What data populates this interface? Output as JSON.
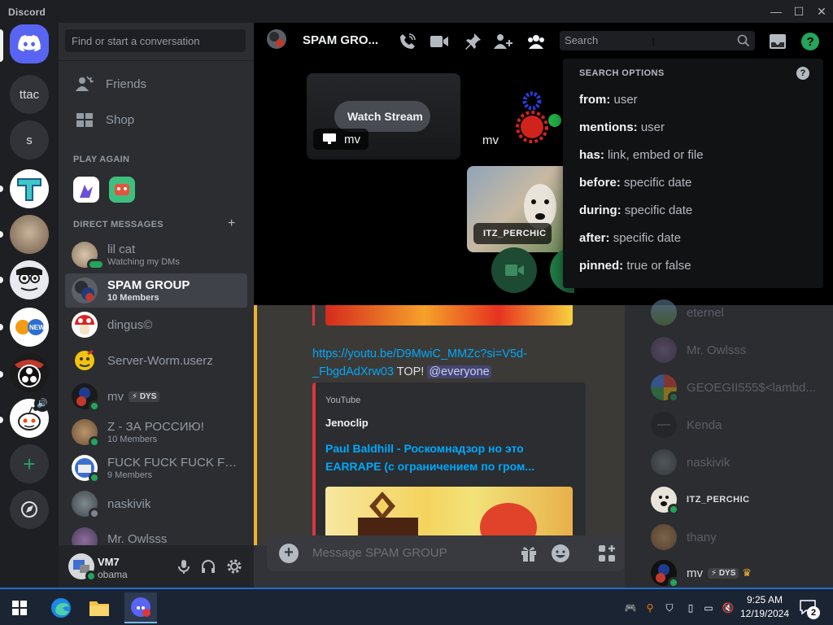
{
  "window": {
    "title": "Discord"
  },
  "guilds": {
    "ttac_label": "ttac",
    "s_label": "s"
  },
  "dm_sidebar": {
    "search_placeholder": "Find or start a conversation",
    "friends_label": "Friends",
    "shop_label": "Shop",
    "play_again_header": "PLAY AGAIN",
    "direct_messages_header": "DIRECT MESSAGES",
    "add_dm": "+",
    "items": [
      {
        "name": "lil cat",
        "sub": "Watching my DMs"
      },
      {
        "name": "SPAM GROUP",
        "sub": "10 Members"
      },
      {
        "name": "dingus©",
        "sub": ""
      },
      {
        "name": "Server-Worm.userz",
        "sub": ""
      },
      {
        "name": "mv",
        "sub": "",
        "tag": "DYS"
      },
      {
        "name": "Z - ЗА РОССИЮ!",
        "sub": "10 Members"
      },
      {
        "name": "FUCK FUCK FUCK FU...",
        "sub": "9 Members"
      },
      {
        "name": "naskivik",
        "sub": ""
      },
      {
        "name": "Mr. Owlsss",
        "sub": ""
      }
    ]
  },
  "user_panel": {
    "username": "VM7",
    "status": "obama"
  },
  "call": {
    "channel_name": "SPAM GRO...",
    "watch_stream_label": "Watch Stream",
    "stream_user": "mv",
    "tile2_user": "mv",
    "tile3_user": "ITZ_PERCHIC"
  },
  "search": {
    "placeholder": "Search"
  },
  "search_options": {
    "header": "SEARCH OPTIONS",
    "help": "?",
    "rows": [
      {
        "key": "from:",
        "value": "user"
      },
      {
        "key": "mentions:",
        "value": "user"
      },
      {
        "key": "has:",
        "value": "link, embed or file"
      },
      {
        "key": "before:",
        "value": "specific date"
      },
      {
        "key": "during:",
        "value": "specific date"
      },
      {
        "key": "after:",
        "value": "specific date"
      },
      {
        "key": "pinned:",
        "value": "true or false"
      }
    ]
  },
  "chat": {
    "link_line1": "https://youtu.be/D9MwiC_MMZc?si=V5d-",
    "link_line2": "_FbgdAdXrw03",
    "link_after": " TOP! ",
    "mention": "@everyone",
    "embed_provider": "YouTube",
    "embed_author": "Jenoclip",
    "embed_title_line1": "Paul Baldhill - Роскомнадзор но это",
    "embed_title_line2": "EARRAPE (с ограничением по гром...",
    "composer_placeholder": "Message SPAM GROUP"
  },
  "members": [
    {
      "name": "eternel"
    },
    {
      "name": "Mr. Owlsss"
    },
    {
      "name": "GEOEGII555$<lambd..."
    },
    {
      "name": "Kenda"
    },
    {
      "name": "naskivik"
    },
    {
      "name": "ITZ_PERCHIC"
    },
    {
      "name": "thany"
    },
    {
      "name": "mv",
      "tag": "DYS"
    }
  ],
  "taskbar": {
    "time": "9:25 AM",
    "date": "12/19/2024",
    "notifications": "2"
  }
}
